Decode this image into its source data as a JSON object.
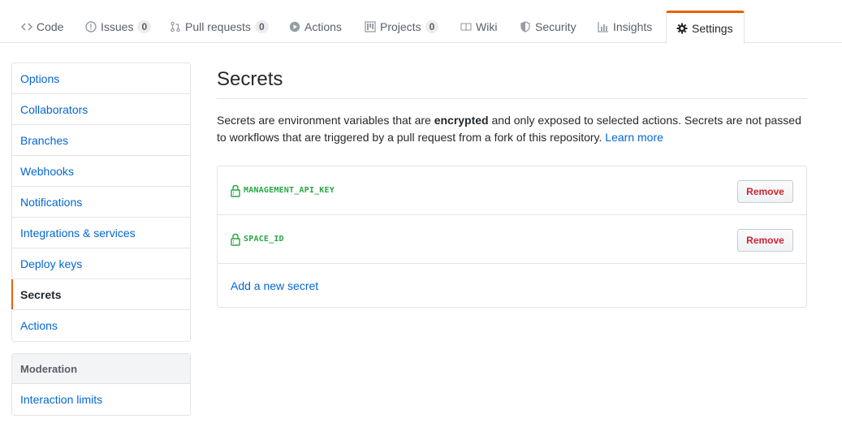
{
  "tabs": [
    {
      "label": "Code",
      "icon": "code-icon"
    },
    {
      "label": "Issues",
      "icon": "issue-icon",
      "count": "0"
    },
    {
      "label": "Pull requests",
      "icon": "pull-request-icon",
      "count": "0"
    },
    {
      "label": "Actions",
      "icon": "play-icon"
    },
    {
      "label": "Projects",
      "icon": "project-icon",
      "count": "0"
    },
    {
      "label": "Wiki",
      "icon": "book-icon"
    },
    {
      "label": "Security",
      "icon": "shield-icon"
    },
    {
      "label": "Insights",
      "icon": "graph-icon"
    },
    {
      "label": "Settings",
      "icon": "gear-icon",
      "selected": true
    }
  ],
  "menu": {
    "items": [
      "Options",
      "Collaborators",
      "Branches",
      "Webhooks",
      "Notifications",
      "Integrations & services",
      "Deploy keys",
      "Secrets",
      "Actions"
    ],
    "selected": "Secrets"
  },
  "moderation": {
    "heading": "Moderation",
    "items": [
      "Interaction limits"
    ]
  },
  "main": {
    "title": "Secrets",
    "desc_before": "Secrets are environment variables that are ",
    "desc_bold": "encrypted",
    "desc_after": " and only exposed to selected actions. Secrets are not passed to workflows that are triggered by a pull request from a fork of this repository. ",
    "learn_more": "Learn more"
  },
  "secrets": [
    {
      "name": "MANAGEMENT_API_KEY",
      "button": "Remove"
    },
    {
      "name": "SPACE_ID",
      "button": "Remove"
    }
  ],
  "add_secret_label": "Add a new secret",
  "colors": {
    "accent": "#e36209",
    "link": "#0366d6",
    "secret": "#28a745",
    "danger": "#cb2431"
  }
}
